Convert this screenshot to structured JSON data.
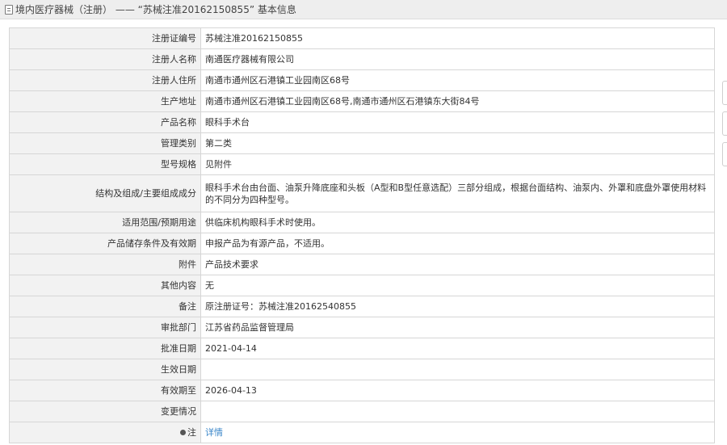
{
  "header": {
    "icon": "document-icon",
    "title": "境内医疗器械（注册） ——  “苏械注准20162150855” 基本信息"
  },
  "rows": [
    {
      "label": "注册证编号",
      "value": "苏械注准20162150855"
    },
    {
      "label": "注册人名称",
      "value": "南通医疗器械有限公司"
    },
    {
      "label": "注册人住所",
      "value": "南通市通州区石港镇工业园南区68号"
    },
    {
      "label": "生产地址",
      "value": "南通市通州区石港镇工业园南区68号,南通市通州区石港镇东大街84号"
    },
    {
      "label": "产品名称",
      "value": "眼科手术台"
    },
    {
      "label": "管理类别",
      "value": "第二类"
    },
    {
      "label": "型号规格",
      "value": "见附件"
    },
    {
      "label": "结构及组成/主要组成成分",
      "value": "眼科手术台由台面、油泵升降底座和头板（A型和B型任意选配）三部分组成，根据台面结构、油泵内、外罩和底盘外罩使用材料的不同分为四种型号。"
    },
    {
      "label": "适用范围/预期用途",
      "value": "供临床机构眼科手术时使用。"
    },
    {
      "label": "产品储存条件及有效期",
      "value": "申报产品为有源产品，不适用。"
    },
    {
      "label": "附件",
      "value": "产品技术要求"
    },
    {
      "label": "其他内容",
      "value": "无"
    },
    {
      "label": "备注",
      "value": "原注册证号：苏械注准20162540855"
    },
    {
      "label": "审批部门",
      "value": "江苏省药品监督管理局"
    },
    {
      "label": "批准日期",
      "value": "2021-04-14"
    },
    {
      "label": "生效日期",
      "value": ""
    },
    {
      "label": "有效期至",
      "value": "2026-04-13"
    },
    {
      "label": "变更情况",
      "value": ""
    },
    {
      "label": "注",
      "value": "详情",
      "icon": "pin-icon"
    }
  ],
  "colors": {
    "label_bg": "#f2f2f2",
    "border": "#d6d6d6",
    "link": "#3a86c9",
    "titlebar_bg": "#eeeeee"
  }
}
